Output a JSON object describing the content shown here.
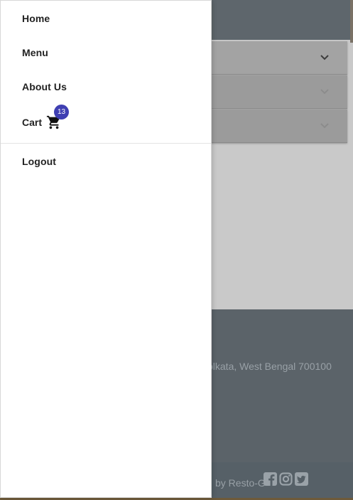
{
  "drawer": {
    "items": [
      {
        "label": "Home"
      },
      {
        "label": "Menu"
      },
      {
        "label": "About Us"
      }
    ],
    "cart": {
      "label": "Cart",
      "count": "13",
      "icon": "shopping-cart-icon"
    },
    "logout": {
      "label": "Logout"
    }
  },
  "background": {
    "accordion_icon": "chevron-down-icon",
    "footer": {
      "address": "olkata, West Bengal 700100",
      "credit": "by Resto-G",
      "social_icons": [
        "facebook-icon",
        "instagram-icon",
        "twitter-icon"
      ]
    }
  },
  "colors": {
    "badge": "#3f3fb2",
    "drawer_bg": "#ffffff",
    "footer_bg": "#5b6369",
    "topbar_bg": "#5e666c"
  }
}
